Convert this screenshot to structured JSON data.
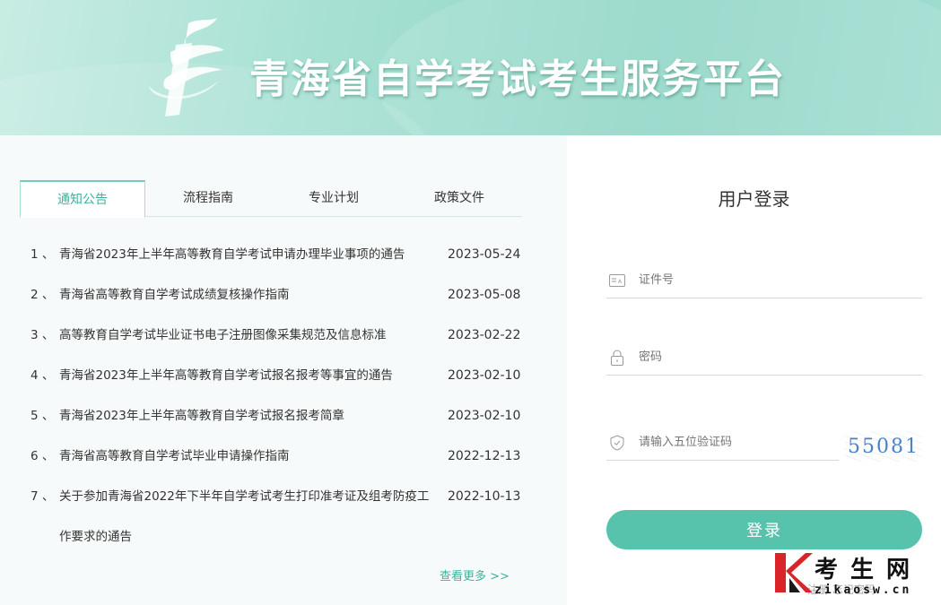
{
  "header": {
    "title": "青海省自学考试考生服务平台"
  },
  "tabs": [
    {
      "label": "通知公告",
      "active": true
    },
    {
      "label": "流程指南",
      "active": false
    },
    {
      "label": "专业计划",
      "active": false
    },
    {
      "label": "政策文件",
      "active": false
    }
  ],
  "notices": [
    {
      "index": "1 、",
      "title": "青海省2023年上半年高等教育自学考试申请办理毕业事项的通告",
      "date": "2023-05-24"
    },
    {
      "index": "2 、",
      "title": "青海省高等教育自学考试成绩复核操作指南",
      "date": "2023-05-08"
    },
    {
      "index": "3 、",
      "title": "高等教育自学考试毕业证书电子注册图像采集规范及信息标准",
      "date": "2023-02-22"
    },
    {
      "index": "4 、",
      "title": "青海省2023年上半年高等教育自学考试报名报考等事宜的通告",
      "date": "2023-02-10"
    },
    {
      "index": "5 、",
      "title": "青海省2023年上半年高等教育自学考试报名报考简章",
      "date": "2023-02-10"
    },
    {
      "index": "6 、",
      "title": "青海省高等教育自学考试毕业申请操作指南",
      "date": "2022-12-13"
    },
    {
      "index": "7 、",
      "title": "关于参加青海省2022年下半年自学考试考生打印准考证及组考防疫工作要求的通告",
      "date": "2022-10-13"
    }
  ],
  "more_label": "查看更多 >>",
  "login": {
    "title": "用户登录",
    "id_placeholder": "证件号",
    "password_placeholder": "密码",
    "captcha_placeholder": "请输入五位验证码",
    "captcha_code": "55081",
    "submit_label": "登录",
    "bottom_links": "注册  忘记密码"
  },
  "watermark": {
    "cn": "考生网",
    "en": "zikaosw.cn"
  },
  "colors": {
    "accent": "#57c3ad",
    "tab_active": "#3bb39d",
    "banner": "#a6e0d3"
  }
}
